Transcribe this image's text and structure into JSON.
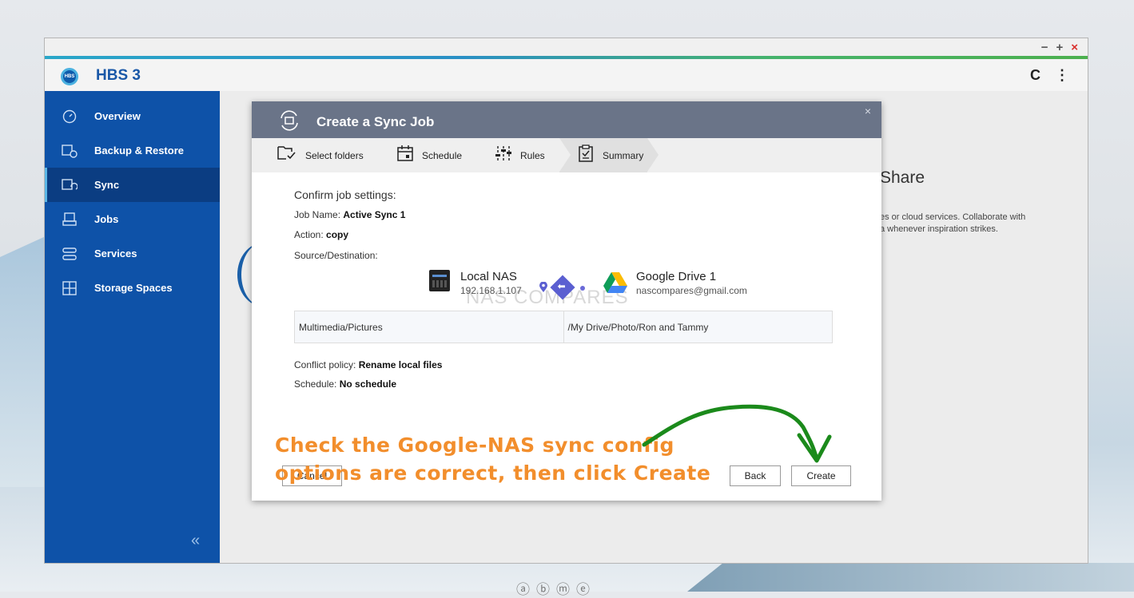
{
  "window": {
    "controls": {
      "minimize": "−",
      "maximize": "+",
      "close": "×"
    }
  },
  "app": {
    "logo_text": "HBS",
    "title": "HBS 3",
    "refresh_icon": "C",
    "menu_icon": "⋮"
  },
  "sidebar": {
    "items": [
      {
        "label": "Overview"
      },
      {
        "label": "Backup & Restore"
      },
      {
        "label": "Sync"
      },
      {
        "label": "Jobs"
      },
      {
        "label": "Services"
      },
      {
        "label": "Storage Spaces"
      }
    ],
    "collapse": "«"
  },
  "background_content": {
    "title_fragment": "Share",
    "desc_line1": "es or cloud services. Collaborate with",
    "desc_line2": "a whenever inspiration strikes."
  },
  "modal": {
    "title": "Create a Sync Job",
    "close": "×",
    "steps": [
      {
        "label": "Select folders"
      },
      {
        "label": "Schedule"
      },
      {
        "label": "Rules"
      },
      {
        "label": "Summary"
      }
    ],
    "confirm": "Confirm job settings:",
    "job_name_label": "Job Name:",
    "job_name": "Active Sync 1",
    "action_label": "Action:",
    "action": "copy",
    "source_dest_label": "Source/Destination:",
    "source": {
      "name": "Local NAS",
      "address": "192.168.1.107"
    },
    "destination": {
      "name": "Google Drive 1",
      "account": "nascompares@gmail.com"
    },
    "source_path": "Multimedia/Pictures",
    "destination_path": "/My Drive/Photo/Ron and Tammy",
    "conflict_label": "Conflict policy:",
    "conflict": "Rename local files",
    "schedule_label": "Schedule:",
    "schedule": "No schedule",
    "buttons": {
      "cancel": "Cancel",
      "back": "Back",
      "create": "Create"
    }
  },
  "watermark": "NAS COMPARES",
  "annotation": {
    "line1": "Check the Google-NAS sync config",
    "line2": "options are correct, then click Create",
    "color": "#f28e2c"
  },
  "bottom_icons": [
    "ⓐ",
    "ⓑ",
    "ⓜ",
    "ⓔ"
  ]
}
